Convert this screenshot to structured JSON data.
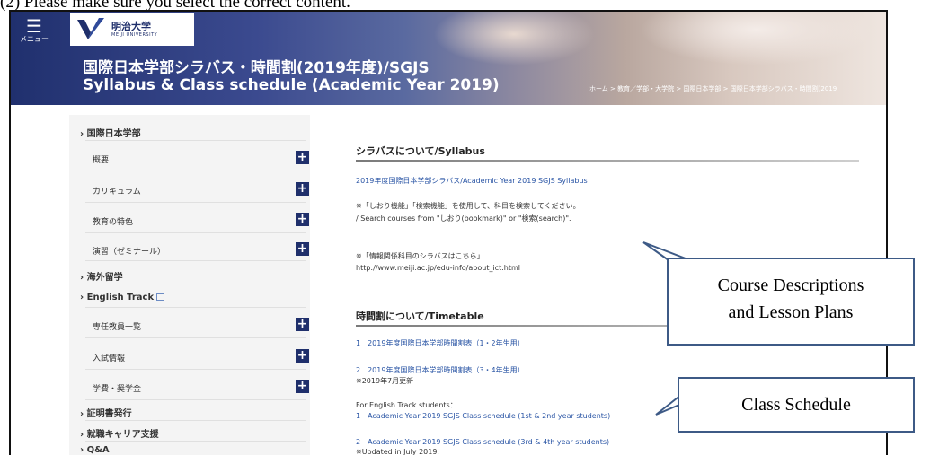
{
  "instruction": "(2) Please make sure you select the correct content.",
  "header": {
    "menu_label": "メニュー",
    "logo_jp": "明治大学",
    "logo_en": "MEIJI UNIVERSITY",
    "title_line1": "国際日本学部シラバス・時間割(2019年度)/SGJS",
    "title_line2": "Syllabus & Class schedule (Academic Year 2019)",
    "breadcrumb": "ホーム > 教育／学部・大学院 > 国際日本学部 > 国際日本学部シラバス・時間割(2019"
  },
  "sidebar": {
    "items": [
      {
        "label": "国際日本学部",
        "type": "parent"
      },
      {
        "label": "概要",
        "type": "child"
      },
      {
        "label": "カリキュラム",
        "type": "child"
      },
      {
        "label": "教育の特色",
        "type": "child"
      },
      {
        "label": "演習（ゼミナール）",
        "type": "child"
      },
      {
        "label": "海外留学",
        "type": "parent"
      },
      {
        "label": "English Track",
        "type": "parent"
      },
      {
        "label": "専任教員一覧",
        "type": "child"
      },
      {
        "label": "入試情報",
        "type": "child"
      },
      {
        "label": "学費・奨学金",
        "type": "child"
      },
      {
        "label": "証明書発行",
        "type": "parent"
      },
      {
        "label": "就職キャリア支援",
        "type": "parent"
      },
      {
        "label": "Q&A",
        "type": "parent"
      }
    ]
  },
  "main": {
    "syllabus_heading": "シラバスについて/Syllabus",
    "syllabus_link": "2019年度国際日本学部シラバス/Academic Year 2019 SGJS Syllabus",
    "note1_jp": "※「しおり機能」「検索機能」を使用して、科目を検索してください。",
    "note1_en": "/ Search courses from \"しおり(bookmark)\" or \"検索(search)\".",
    "note2": "※「情報関係科目のシラバスはこちら」",
    "note2_url": "http://www.meiji.ac.jp/edu-info/about_ict.html",
    "timetable_heading": "時間割について/Timetable",
    "tt_link1": "1　2019年度国際日本学部時間割表（1・2年生用）",
    "tt_link2": "2　2019年度国際日本学部時間割表（3・4年生用）",
    "tt_note_jp": "※2019年7月更新",
    "et_label": "For English Track students：",
    "et_link1": "1　Academic Year 2019 SGJS Class schedule (1st & 2nd year students)",
    "et_link2": "2　Academic Year 2019 SGJS Class schedule (3rd & 4th year students)",
    "et_note": "※Updated in July 2019."
  },
  "callouts": {
    "course_desc_line1": "Course Descriptions",
    "course_desc_line2": "and Lesson Plans",
    "class_schedule": "Class Schedule"
  },
  "colors": {
    "accent": "#1f2f6b",
    "link": "#2a55a5",
    "callout_border": "#3d5a86"
  }
}
